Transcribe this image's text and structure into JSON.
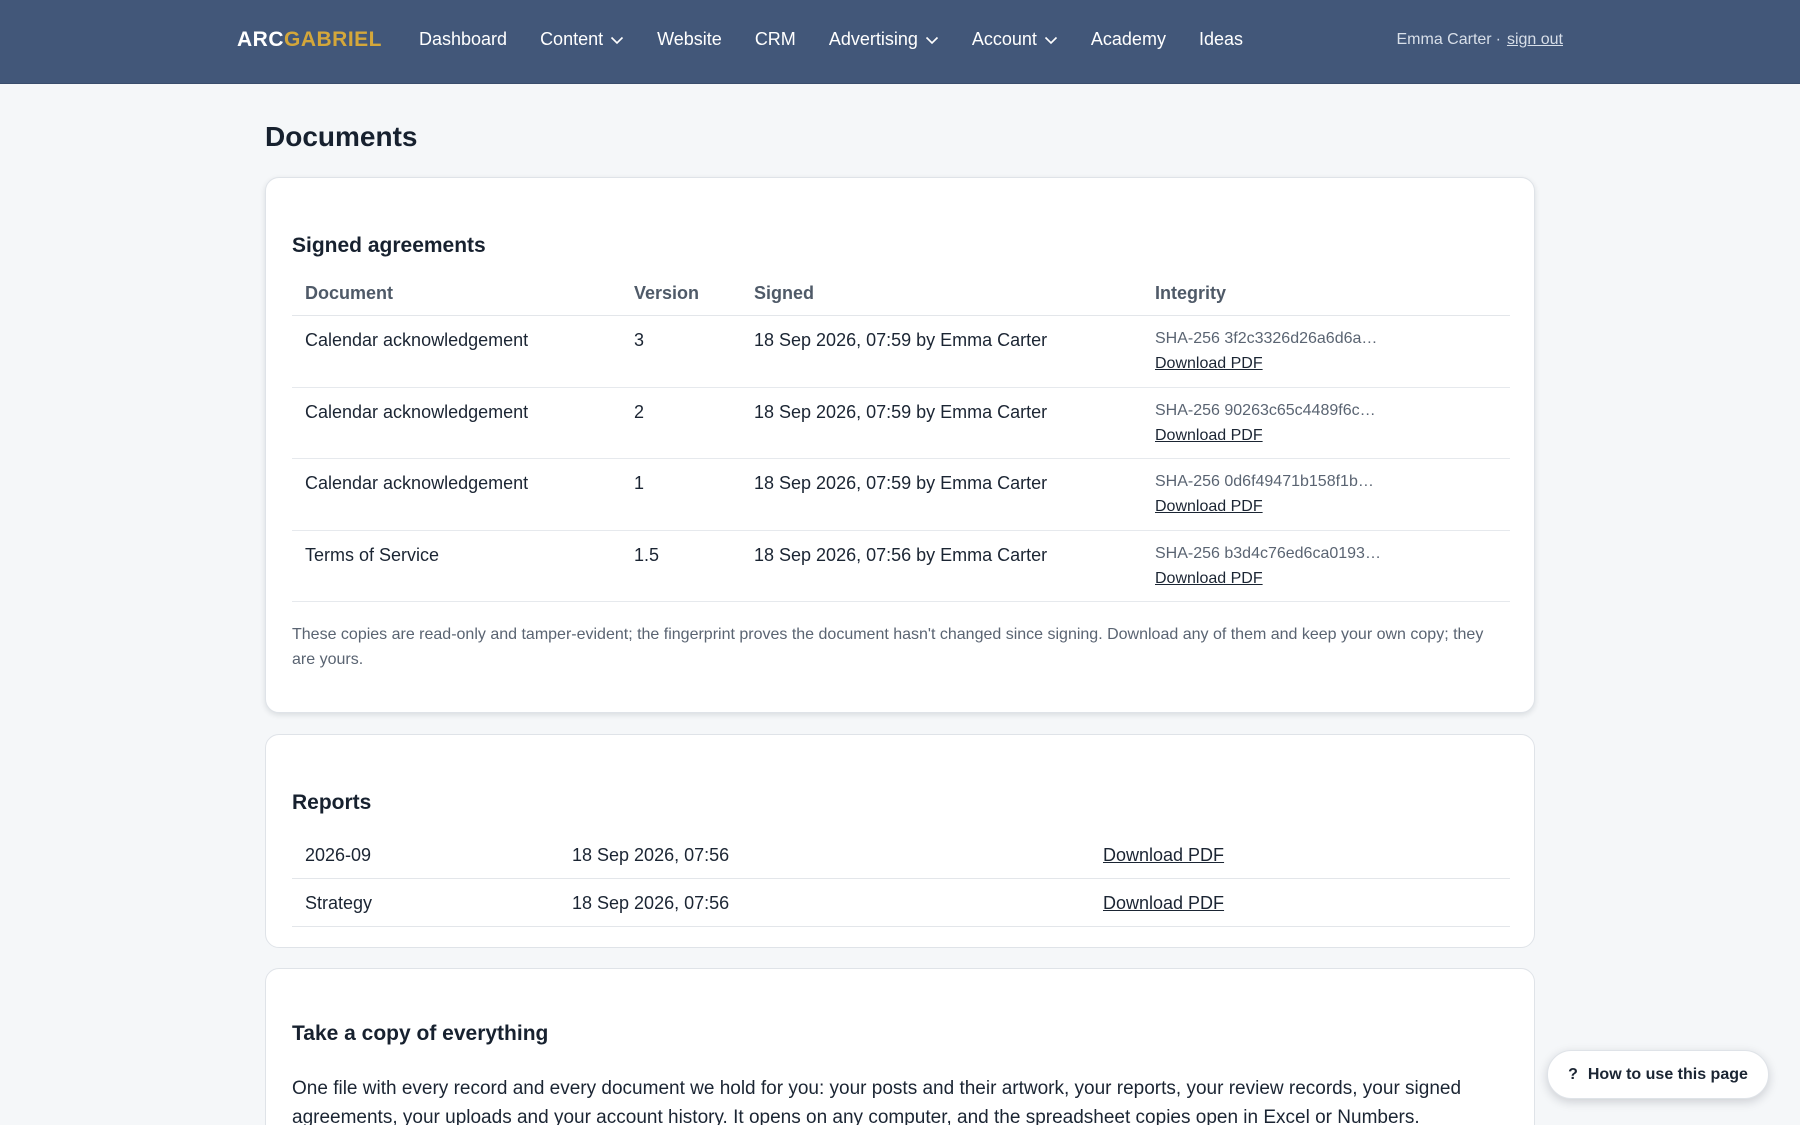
{
  "brand": {
    "part1": "ARC",
    "part2": "GABRIEL"
  },
  "nav": {
    "dashboard": "Dashboard",
    "content": "Content",
    "website": "Website",
    "crm": "CRM",
    "advertising": "Advertising",
    "account": "Account",
    "academy": "Academy",
    "ideas": "Ideas"
  },
  "user": {
    "name": "Emma Carter",
    "separator": "·",
    "sign_out": "sign out"
  },
  "page": {
    "title": "Documents"
  },
  "signed_agreements": {
    "heading": "Signed agreements",
    "columns": {
      "document": "Document",
      "version": "Version",
      "signed": "Signed",
      "integrity": "Integrity"
    },
    "rows": [
      {
        "document": "Calendar acknowledgement",
        "version": "3",
        "signed": "18 Sep 2026, 07:59 by Emma Carter",
        "hash": "SHA-256 3f2c3326d26a6d6a…",
        "download": "Download PDF"
      },
      {
        "document": "Calendar acknowledgement",
        "version": "2",
        "signed": "18 Sep 2026, 07:59 by Emma Carter",
        "hash": "SHA-256 90263c65c4489f6c…",
        "download": "Download PDF"
      },
      {
        "document": "Calendar acknowledgement",
        "version": "1",
        "signed": "18 Sep 2026, 07:59 by Emma Carter",
        "hash": "SHA-256 0d6f49471b158f1b…",
        "download": "Download PDF"
      },
      {
        "document": "Terms of Service",
        "version": "1.5",
        "signed": "18 Sep 2026, 07:56 by Emma Carter",
        "hash": "SHA-256 b3d4c76ed6ca0193…",
        "download": "Download PDF"
      }
    ],
    "note": "These copies are read-only and tamper-evident; the fingerprint proves the document hasn't changed since signing. Download any of them and keep your own copy; they are yours."
  },
  "reports": {
    "heading": "Reports",
    "rows": [
      {
        "name": "2026-09",
        "date": "18 Sep 2026, 07:56",
        "download": "Download PDF"
      },
      {
        "name": "Strategy",
        "date": "18 Sep 2026, 07:56",
        "download": "Download PDF"
      }
    ]
  },
  "copy_all": {
    "heading": "Take a copy of everything",
    "text": "One file with every record and every document we hold for you: your posts and their artwork, your reports, your review records, your signed agreements, your uploads and your account history. It opens on any computer, and the spreadsheet copies open in Excel or Numbers."
  },
  "help": {
    "icon": "?",
    "label": "How to use this page"
  },
  "colors": {
    "topbar": "#425779",
    "brand_accent": "#d4a73a",
    "page_bg": "#f5f7f9"
  },
  "icons": {
    "dropdown": "chevron-down-icon",
    "help": "question-icon"
  }
}
